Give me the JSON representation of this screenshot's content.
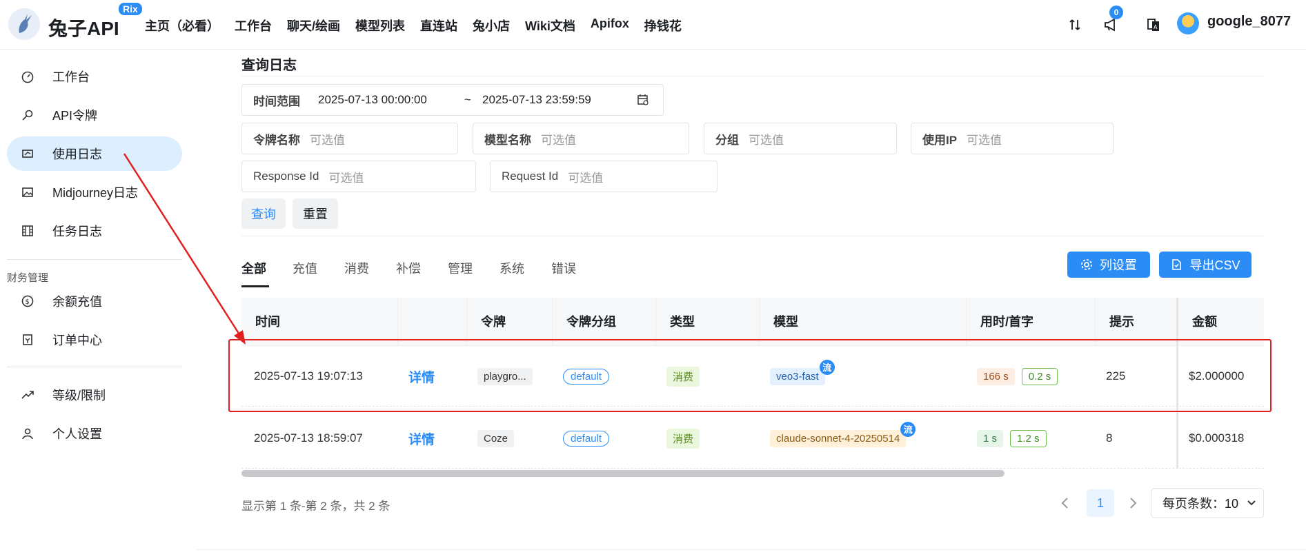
{
  "header": {
    "brand": "兔子API",
    "brand_badge": "Rix",
    "nav": [
      "主页（必看）",
      "工作台",
      "聊天/绘画",
      "模型列表",
      "直连站",
      "兔小店",
      "Wiki文档",
      "Apifox",
      "挣钱花"
    ],
    "notification_count": "0",
    "username": "google_8077"
  },
  "sidebar": {
    "items": [
      {
        "label": "工作台",
        "icon": "dashboard-icon"
      },
      {
        "label": "API令牌",
        "icon": "key-icon"
      },
      {
        "label": "使用日志",
        "icon": "log-icon"
      },
      {
        "label": "Midjourney日志",
        "icon": "image-icon"
      },
      {
        "label": "任务日志",
        "icon": "film-icon"
      }
    ],
    "group_label": "财务管理",
    "finance_items": [
      {
        "label": "余额充值",
        "icon": "coin-icon"
      },
      {
        "label": "订单中心",
        "icon": "order-icon"
      }
    ],
    "other_items": [
      {
        "label": "等级/限制",
        "icon": "trend-icon"
      },
      {
        "label": "个人设置",
        "icon": "user-icon"
      }
    ]
  },
  "page": {
    "title": "查询日志"
  },
  "filters": {
    "time_label": "时间范围",
    "time_start": "2025-07-13 00:00:00",
    "time_sep": "~",
    "time_end": "2025-07-13 23:59:59",
    "token_label": "令牌名称",
    "model_label": "模型名称",
    "group_label": "分组",
    "ip_label": "使用IP",
    "response_label": "Response Id",
    "request_label": "Request Id",
    "placeholder": "可选值",
    "query_button": "查询",
    "reset_button": "重置"
  },
  "tabs": [
    "全部",
    "充值",
    "消费",
    "补偿",
    "管理",
    "系统",
    "错误"
  ],
  "actions": {
    "columns": "列设置",
    "export": "导出CSV"
  },
  "table": {
    "headers": [
      "时间",
      "",
      "令牌",
      "令牌分组",
      "类型",
      "模型",
      "用时/首字",
      "提示",
      "金额"
    ],
    "rows": [
      {
        "time": "2025-07-13 19:07:13",
        "detail": "详情",
        "token": "playgro...",
        "group": "default",
        "type": "消费",
        "model": "veo3-fast",
        "stream": "流",
        "duration": "166 s",
        "first": "0.2 s",
        "prompt": "225",
        "amount": "$2.000000"
      },
      {
        "time": "2025-07-13 18:59:07",
        "detail": "详情",
        "token": "Coze",
        "group": "default",
        "type": "消费",
        "model": "claude-sonnet-4-20250514",
        "stream": "流",
        "duration": "1 s",
        "first": "1.2 s",
        "prompt": "8",
        "amount": "$0.000318"
      }
    ]
  },
  "pagination": {
    "summary": "显示第 1 条-第 2 条，共 2 条",
    "current": "1",
    "page_size": "每页条数：10"
  },
  "annotation_color": "#e02020"
}
